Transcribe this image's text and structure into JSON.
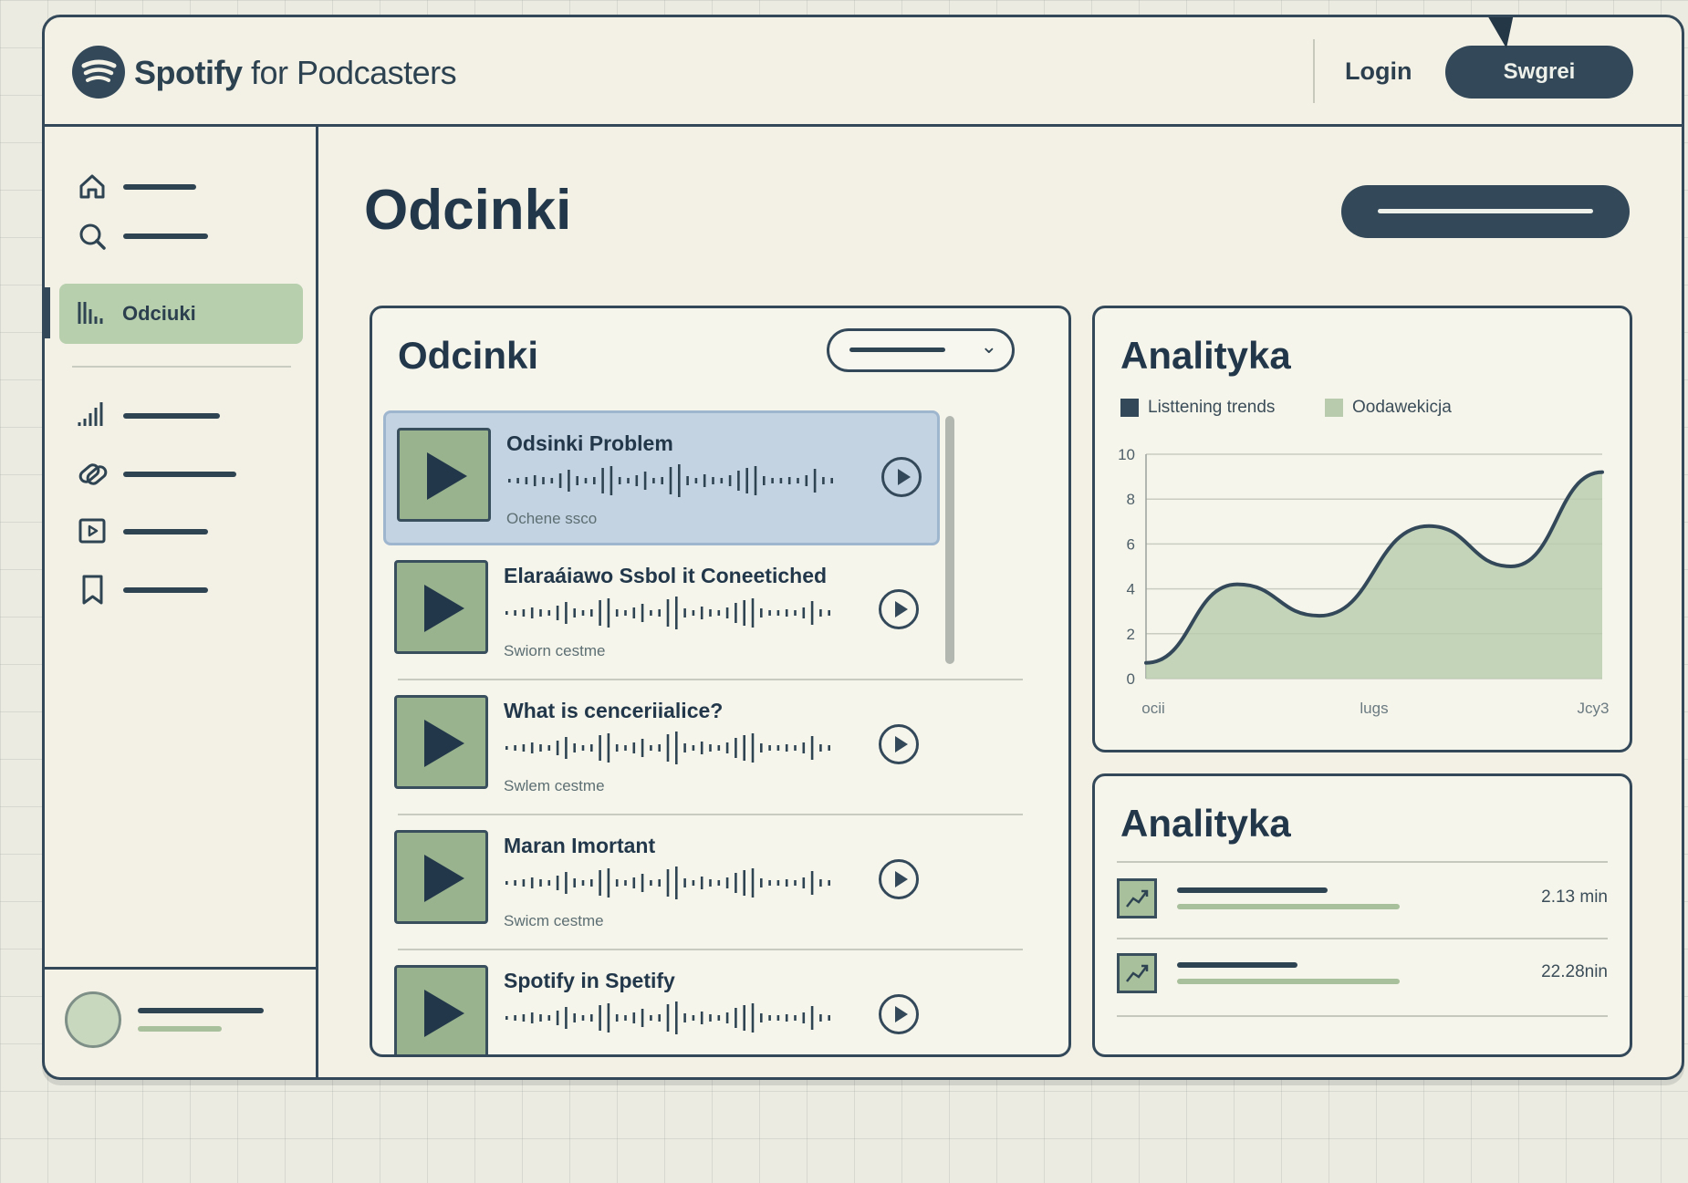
{
  "header": {
    "brand_bold": "Spotify",
    "brand_rest": " for Podcasters",
    "login_label": "Login",
    "cta_label": "Swgrei"
  },
  "sidebar": {
    "active_label": "Odciuki"
  },
  "page": {
    "title": "Odcinki"
  },
  "episodes_panel": {
    "title": "Odcinki",
    "episodes": [
      {
        "title": "Odsinki Problem",
        "subtitle": "Ochene ssco",
        "highlighted": true
      },
      {
        "title": "Elaraáiawo Ssbol it Coneetiched",
        "subtitle": "Swiorn cestme",
        "highlighted": false
      },
      {
        "title": "What is cenceriialice?",
        "subtitle": "Swlem cestme",
        "highlighted": false
      },
      {
        "title": "Maran Imortant",
        "subtitle": "Swicm cestme",
        "highlighted": false
      },
      {
        "title": "Spotify in Spetify",
        "subtitle": "",
        "highlighted": false
      }
    ]
  },
  "analytics_chart_panel": {
    "title": "Analityka",
    "chart_data": {
      "type": "area",
      "series": [
        {
          "name": "Listtening trends",
          "color": "#33495a"
        },
        {
          "name": "Oodawekicja",
          "color": "#b8ccad"
        }
      ],
      "x_tick_labels": [
        "ocii",
        "lugs",
        "Jcy3"
      ],
      "y_ticks": [
        0,
        2,
        4,
        6,
        8,
        10
      ],
      "ylim": [
        0,
        10
      ],
      "x": [
        0,
        0.2,
        0.38,
        0.62,
        0.8,
        1.0
      ],
      "values": [
        0.7,
        4.2,
        2.8,
        6.8,
        5.0,
        9.2
      ]
    }
  },
  "analytics_stats_panel": {
    "title": "Analityka",
    "rows": [
      {
        "value": "2.13 min"
      },
      {
        "value": "22.28nin"
      }
    ]
  },
  "colors": {
    "accent": "#33495a",
    "green": "#b8cfae",
    "highlight": "#c4d3e1"
  }
}
